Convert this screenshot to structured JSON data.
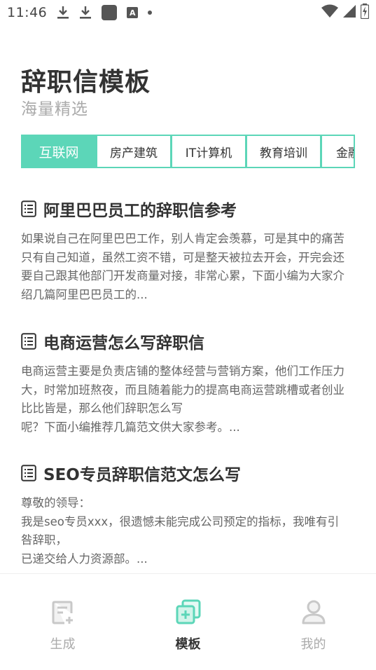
{
  "status_bar": {
    "time": "11:46",
    "abox_letter": "A",
    "icons": [
      "download-icon",
      "download-icon",
      "app-square-icon",
      "a-box-icon",
      "dot-icon",
      "wifi-icon",
      "signal-icon",
      "battery-charging-icon"
    ]
  },
  "header": {
    "title": "辞职信模板",
    "subtitle": "海量精选"
  },
  "tabs": [
    {
      "label": "互联网",
      "active": true
    },
    {
      "label": "房产建筑",
      "active": false
    },
    {
      "label": "IT计算机",
      "active": false
    },
    {
      "label": "教育培训",
      "active": false
    },
    {
      "label": "金融",
      "active": false
    }
  ],
  "articles": [
    {
      "title": "阿里巴巴员工的辞职信参考",
      "body": "如果说自己在阿里巴巴工作，别人肯定会羡慕，可是其中的痛苦只有自己知道，虽然工资不错，可是整天被拉去开会，开完会还要自己跟其他部门开发商量对接，非常心累，下面小编为大家介绍几篇阿里巴巴员工的..."
    },
    {
      "title": "电商运营怎么写辞职信",
      "body": "电商运营主要是负责店铺的整体经营与营销方案，他们工作压力大，时常加班熬夜，而且随着能力的提高电商运营跳槽或者创业比比皆是，那么他们辞职怎么写\n呢？下面小编推荐几篇范文供大家参考。..."
    },
    {
      "title": "SEO专员辞职信范文怎么写",
      "body": "尊敬的领导：\n我是seo专员xxx，很遗憾未能完成公司预定的指标，我唯有引咎辞职，\n已递交给人力资源部。..."
    }
  ],
  "bottom_nav": [
    {
      "label": "生成",
      "icon": "edit-doc-icon",
      "active": false
    },
    {
      "label": "模板",
      "icon": "template-add-icon",
      "active": true
    },
    {
      "label": "我的",
      "icon": "user-icon",
      "active": false
    }
  ],
  "colors": {
    "accent": "#5cd6b8",
    "text_primary": "#333333",
    "text_secondary": "#666666",
    "text_muted": "#aaaaaa"
  }
}
